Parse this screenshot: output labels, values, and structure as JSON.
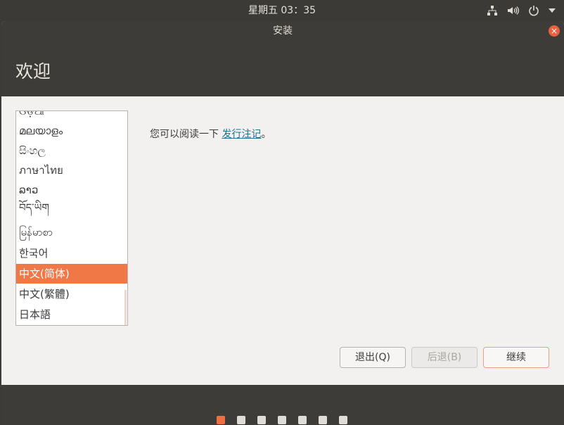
{
  "topbar": {
    "clock": "星期五 03：35",
    "tray_icons": [
      "network-icon",
      "volume-icon",
      "power-icon",
      "dropdown-arrow-icon"
    ]
  },
  "window": {
    "title": "安装",
    "close_symbol": "×"
  },
  "header": {
    "title": "欢迎"
  },
  "languages": {
    "items": [
      "ଓଡ଼ିଆ",
      "മലയാളം",
      "සිංහල",
      "ภาษาไทย",
      "ລາວ",
      "བོད་ཡིག",
      "မြန်မာစာ",
      "한국어",
      "中文(简体)",
      "中文(繁體)",
      "日本語"
    ],
    "selected": "中文(简体)"
  },
  "release_notes": {
    "prefix": "您可以阅读一下 ",
    "link": "发行注记",
    "suffix": "。"
  },
  "buttons": {
    "quit": "退出(Q)",
    "back": "后退(B)",
    "continue": "继续"
  },
  "progress": {
    "total_steps": 7,
    "current_step": 1
  },
  "colors": {
    "accent": "#f07746",
    "link": "#19758e",
    "panel": "#3d3c38"
  }
}
